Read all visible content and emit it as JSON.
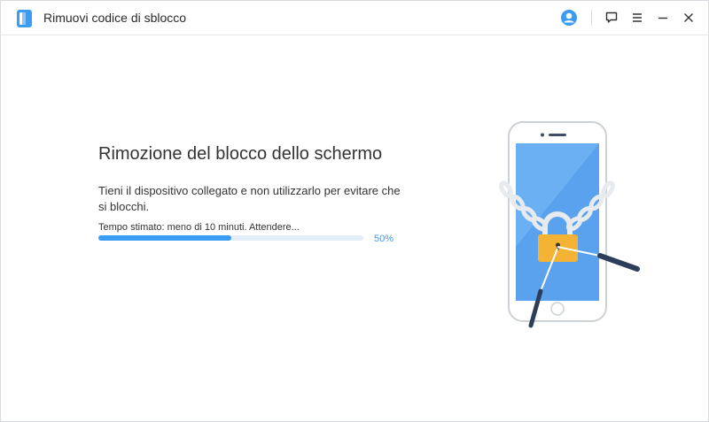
{
  "app": {
    "title": "Rimuovi codice di sblocco"
  },
  "header": {
    "icons": [
      "user-icon",
      "feedback-icon",
      "menu-icon",
      "minimize-icon",
      "close-icon"
    ]
  },
  "main": {
    "title": "Rimozione del blocco dello schermo",
    "description": "Tieni il dispositivo collegato e non utilizzarlo per evitare che si blocchi.",
    "estimate": "Tempo stimato: meno di 10 minuti. Attendere...",
    "progress_fraction": 0.5,
    "progress_label": "50%"
  },
  "colors": {
    "accent": "#3a9cf3",
    "progress_track": "#e3eef9",
    "lock": "#f5b335",
    "screen": "#5ba2ee"
  },
  "illustration": {
    "name": "phone-unlock-illustration",
    "icons": [
      "phone-icon",
      "chain-icon",
      "padlock-icon",
      "lockpick-icon"
    ]
  }
}
